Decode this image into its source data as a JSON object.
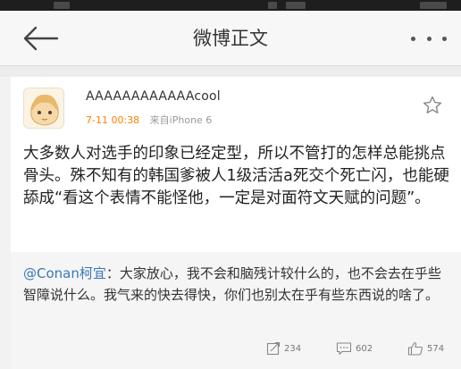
{
  "nav": {
    "title": "微博正文"
  },
  "post": {
    "username": "AAAAAAAAAAAAcool",
    "time": "7-11 00:38",
    "source": "来自iPhone 6",
    "text": "大多数人对选手的印象已经定型，所以不管打的怎样总能挑点骨头。殊不知有的韩国爹被人1级活活a死交个死亡闪，也能硬舔成“看这个表情不能怪他，一定是对面符文天赋的问题”。"
  },
  "repost": {
    "mention": "@Conan柯宜",
    "text": "：大家放心，我不会和脑残计较什么的，也不会去在乎些智障说什么。我气来的快去得快，你们也别太在乎有些东西说的啥了。",
    "reposts": "234",
    "comments": "602",
    "likes": "574"
  },
  "colors": {
    "accent_orange": "#ff8200",
    "mention_blue": "#3a78b8"
  },
  "icons": {
    "back": "back-arrow-icon",
    "more": "more-dots-icon",
    "star": "star-icon",
    "repost": "repost-icon",
    "comment": "comment-icon",
    "like": "thumbs-up-icon"
  }
}
